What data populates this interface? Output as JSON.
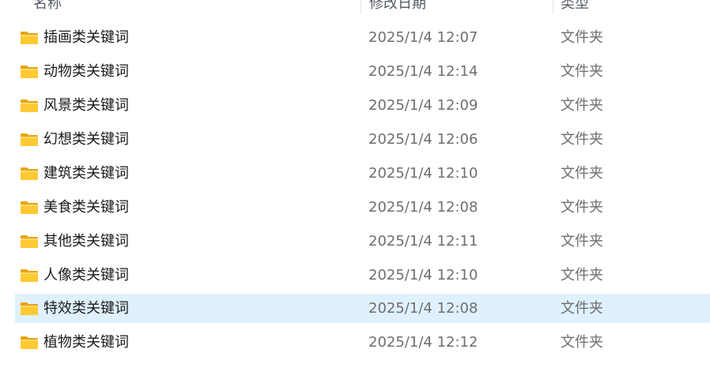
{
  "columns": {
    "name": "名称",
    "date": "修改日期",
    "type": "类型"
  },
  "rows": [
    {
      "name": "插画类关键词",
      "date": "2025/1/4 12:07",
      "type": "文件夹",
      "icon": "folder-icon",
      "selected": false
    },
    {
      "name": "动物类关键词",
      "date": "2025/1/4 12:14",
      "type": "文件夹",
      "icon": "folder-icon",
      "selected": false
    },
    {
      "name": "风景类关键词",
      "date": "2025/1/4 12:09",
      "type": "文件夹",
      "icon": "folder-icon",
      "selected": false
    },
    {
      "name": "幻想类关键词",
      "date": "2025/1/4 12:06",
      "type": "文件夹",
      "icon": "folder-icon",
      "selected": false
    },
    {
      "name": "建筑类关键词",
      "date": "2025/1/4 12:10",
      "type": "文件夹",
      "icon": "folder-icon",
      "selected": false
    },
    {
      "name": "美食类关键词",
      "date": "2025/1/4 12:08",
      "type": "文件夹",
      "icon": "folder-icon",
      "selected": false
    },
    {
      "name": "其他类关键词",
      "date": "2025/1/4 12:11",
      "type": "文件夹",
      "icon": "folder-icon",
      "selected": false
    },
    {
      "name": "人像类关键词",
      "date": "2025/1/4 12:10",
      "type": "文件夹",
      "icon": "folder-icon",
      "selected": false
    },
    {
      "name": "特效类关键词",
      "date": "2025/1/4 12:08",
      "type": "文件夹",
      "icon": "folder-icon",
      "selected": true
    },
    {
      "name": "植物类关键词",
      "date": "2025/1/4 12:12",
      "type": "文件夹",
      "icon": "folder-icon",
      "selected": false
    }
  ],
  "colors": {
    "selected_row": "#dff1fd",
    "folder_yellow": "#ffc933",
    "folder_dark": "#e8a317"
  }
}
